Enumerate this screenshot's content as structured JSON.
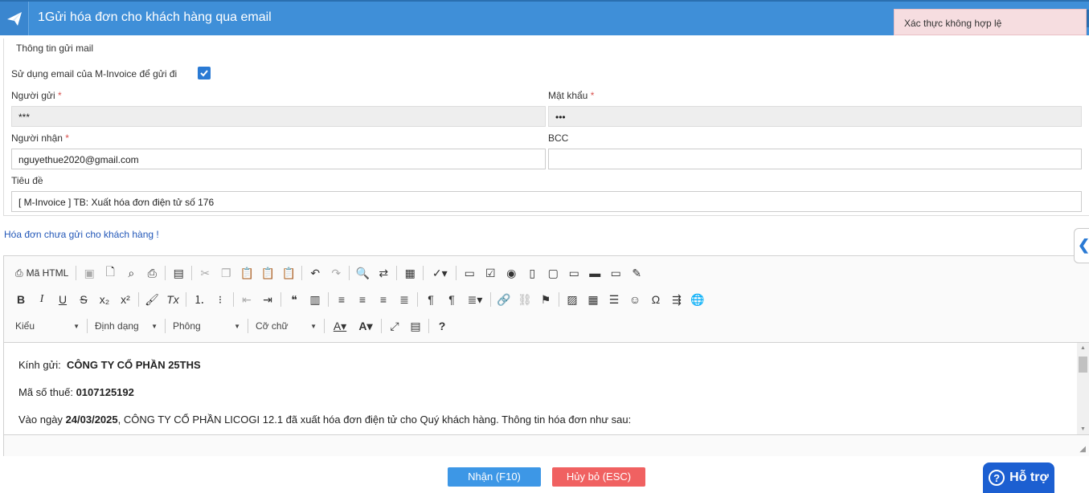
{
  "window": {
    "title": "1Gửi hóa đơn cho khách hàng qua email"
  },
  "toast": {
    "message": "Xác thực không hợp lệ"
  },
  "form": {
    "section_title": "Thông tin gửi mail",
    "use_minvoice_label": "Sử dụng email của M-Invoice để gửi đi",
    "use_minvoice_checked": true,
    "sender_label": "Người gửi",
    "sender_value": "***",
    "password_label": "Mật khẩu",
    "password_value": "•••",
    "recipient_label": "Người nhận",
    "recipient_value": "nguyethue2020@gmail.com",
    "bcc_label": "BCC",
    "bcc_value": "",
    "subject_label": "Tiêu đề",
    "subject_value": "[ M-Invoice ] TB: Xuất hóa đơn điện tử số 176",
    "required_mark": "*"
  },
  "notice": "Hóa đơn chưa gửi cho khách hàng !",
  "editor": {
    "html_button": "Mã HTML",
    "combos": {
      "style": "Kiểu",
      "format": "Định dạng",
      "font": "Phông",
      "size": "Cỡ chữ"
    },
    "content": {
      "greeting_label": "Kính gửi:",
      "greeting_value": "CÔNG TY CỔ PHẦN 25THS",
      "tax_label": "Mã số thuế:",
      "tax_value": "0107125192",
      "line3_prefix": "Vào ngày",
      "line3_date": "24/03/2025",
      "line3_rest": ",  CÔNG TY CỔ PHẦN LICOGI 12.1  đã xuất hóa đơn điện tử cho Quý khách hàng. Thông tin hóa đơn như sau:"
    }
  },
  "buttons": {
    "ok": "Nhận (F10)",
    "cancel": "Hủy bỏ (ESC)"
  },
  "support": {
    "label": "Hỗ trợ"
  },
  "colors": {
    "titlebar": "#3f8fd8",
    "ok": "#3d97e6",
    "cancel": "#f06161",
    "support": "#1c5fd1",
    "toast_bg": "#f6dde0"
  }
}
